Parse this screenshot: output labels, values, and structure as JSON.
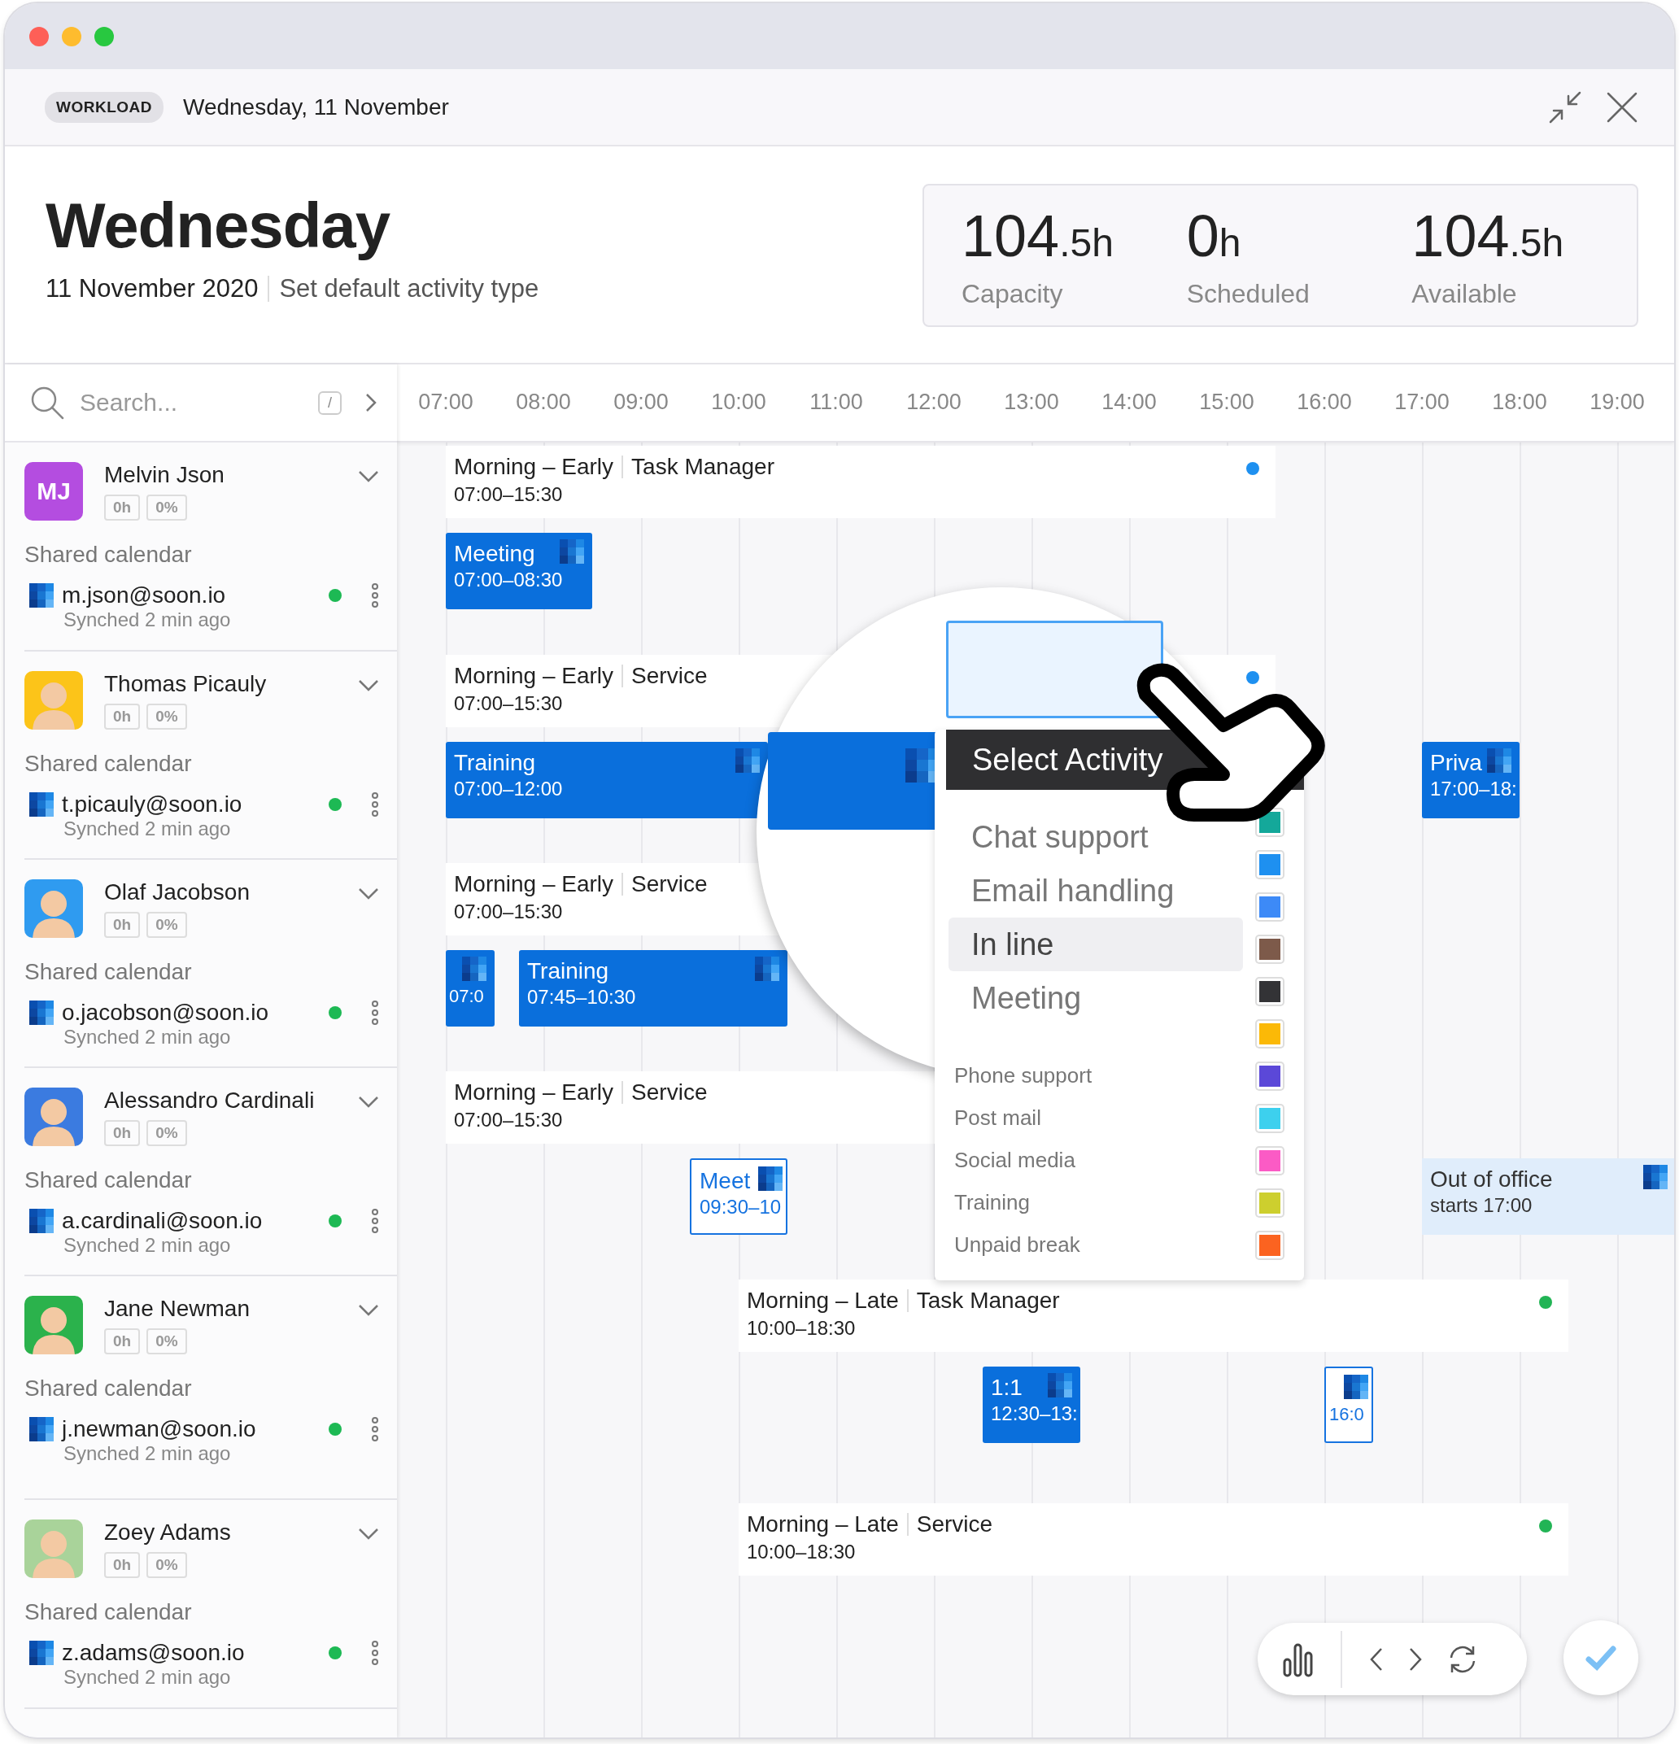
{
  "header": {
    "badge": "WORKLOAD",
    "date": "Wednesday, 11 November"
  },
  "day": {
    "title": "Wednesday",
    "date": "11 November 2020",
    "action": "Set default activity type"
  },
  "stats": [
    {
      "value": "104",
      "unit": ".5h",
      "label": "Capacity"
    },
    {
      "value": "0",
      "unit": "h",
      "label": "Scheduled"
    },
    {
      "value": "104",
      "unit": ".5h",
      "label": "Available"
    }
  ],
  "search": {
    "placeholder": "Search...",
    "shortcut": "/"
  },
  "hours": [
    "07:00",
    "08:00",
    "09:00",
    "10:00",
    "11:00",
    "12:00",
    "13:00",
    "14:00",
    "15:00",
    "16:00",
    "17:00",
    "18:00",
    "19:00"
  ],
  "people": [
    {
      "name": "Melvin Json",
      "avatar": {
        "kind": "initials",
        "text": "MJ",
        "color": "#b44de0"
      },
      "hours": "0h",
      "percent": "0%",
      "calendar_label": "Shared calendar",
      "email": "m.json@soon.io",
      "sync": "Synched 2 min ago",
      "connected": true
    },
    {
      "name": "Thomas Picauly",
      "hours": "0h",
      "percent": "0%",
      "calendar_label": "Shared calendar",
      "email": "t.picauly@soon.io",
      "sync": "Synched 2 min ago",
      "connected": true
    },
    {
      "name": "Olaf Jacobson",
      "hours": "0h",
      "percent": "0%",
      "calendar_label": "Shared calendar",
      "email": "o.jacobson@soon.io",
      "sync": "Synched 2 min ago",
      "connected": true
    },
    {
      "name": "Alessandro Cardinali",
      "hours": "0h",
      "percent": "0%",
      "calendar_label": "Shared calendar",
      "email": "a.cardinali@soon.io",
      "sync": "Synched 2 min ago",
      "connected": true
    },
    {
      "name": "Jane Newman",
      "hours": "0h",
      "percent": "0%",
      "calendar_label": "Shared calendar",
      "email": "j.newman@soon.io",
      "sync": "Synched 2 min ago",
      "connected": true
    },
    {
      "name": "Zoey Adams",
      "hours": "0h",
      "percent": "0%",
      "calendar_label": "Shared calendar",
      "email": "z.adams@soon.io",
      "sync": "Synched 2 min ago",
      "connected": true
    }
  ],
  "lanes": [
    {
      "shifts": [
        {
          "title": "Morning – Early",
          "team": "Task Manager",
          "time": "07:00–15:30",
          "color": "#1e90f0"
        }
      ],
      "events": [
        {
          "kind": "solid",
          "title": "Meeting",
          "time": "07:00–08:30"
        }
      ]
    },
    {
      "shifts": [
        {
          "title": "Morning – Early",
          "team": "Service",
          "time": "07:00–15:30",
          "color": "#1e90f0"
        }
      ],
      "events": [
        {
          "kind": "solid",
          "title": "Training",
          "time": "07:00–12:00"
        },
        {
          "kind": "solid",
          "title": "Priva",
          "time": "17:00–18:"
        }
      ]
    },
    {
      "shifts": [
        {
          "title": "Morning – Early",
          "team": "Service",
          "time": "07:00–15:30"
        }
      ],
      "events": [
        {
          "kind": "solid",
          "time": "07:0"
        },
        {
          "kind": "solid",
          "title": "Training",
          "time": "07:45–10:30"
        }
      ]
    },
    {
      "shifts": [
        {
          "title": "Morning – Early",
          "team": "Service",
          "time": "07:00–15:30"
        }
      ],
      "events": [
        {
          "kind": "outline",
          "title": "Meet",
          "time": "09:30–10"
        },
        {
          "kind": "absence",
          "title": "Out of office",
          "time": "starts 17:00"
        }
      ]
    },
    {
      "shifts": [
        {
          "title": "Morning – Late",
          "team": "Task Manager",
          "time": "10:00–18:30",
          "color": "#22b455"
        }
      ],
      "events": [
        {
          "kind": "solid",
          "title": "1:1",
          "time": "12:30–13:"
        },
        {
          "kind": "outline",
          "time": "16:0"
        }
      ]
    },
    {
      "shifts": [
        {
          "title": "Morning – Late",
          "team": "Service",
          "time": "10:00–18:30",
          "color": "#22b455"
        }
      ]
    }
  ],
  "menu": {
    "title": "Select Activity",
    "magnified_items": [
      {
        "label": "Chat support",
        "selected": false
      },
      {
        "label": "Email handling",
        "selected": false
      },
      {
        "label": "In line",
        "selected": true
      },
      {
        "label": "Meeting",
        "selected": false
      }
    ],
    "items": [
      {
        "label": "Phone support",
        "selected": false
      },
      {
        "label": "Post mail",
        "selected": false
      },
      {
        "label": "Social media",
        "selected": false
      },
      {
        "label": "Training",
        "selected": false
      },
      {
        "label": "Unpaid break",
        "selected": false
      }
    ],
    "swatches": [
      {
        "color": "#14a89a"
      },
      {
        "color": "#1e90f0"
      },
      {
        "color": "#3d8af7"
      },
      {
        "color": "#7d5a4a"
      },
      {
        "color": "#333336"
      },
      {
        "color": "#fbb907"
      },
      {
        "color": "#5b48d8"
      },
      {
        "color": "#3dd0ee"
      },
      {
        "color": "#fb5bc5"
      },
      {
        "color": "#cdcf2e"
      },
      {
        "color": "#fb6320"
      }
    ]
  }
}
